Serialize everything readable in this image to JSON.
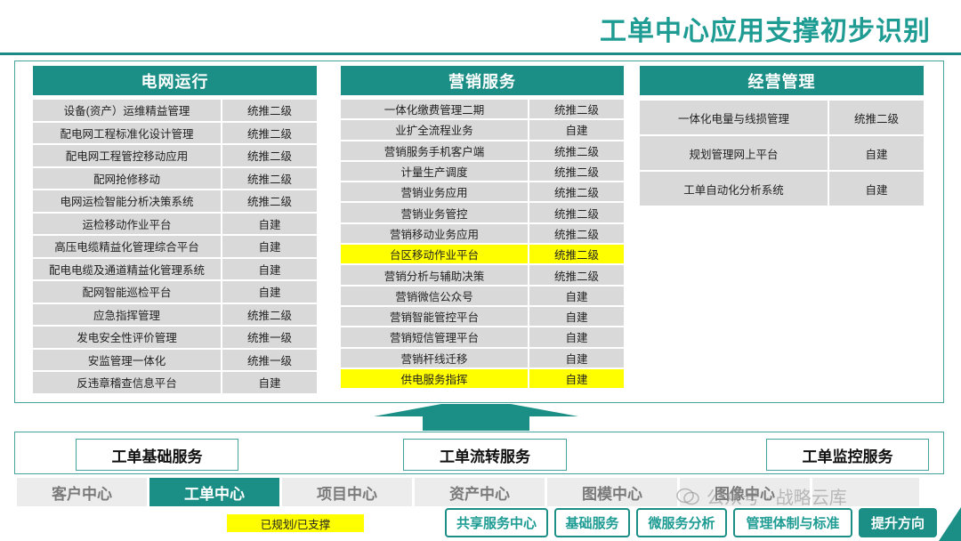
{
  "title": "工单中心应用支撑初步识别",
  "panels": {
    "grid": {
      "title": "电网运行",
      "rows": [
        {
          "name": "设备(资产）运维精益管理",
          "level": "统推二级"
        },
        {
          "name": "配电网工程标准化设计管理",
          "level": "统推二级"
        },
        {
          "name": "配电网工程管控移动应用",
          "level": "统推二级"
        },
        {
          "name": "配网抢修移动",
          "level": "统推二级"
        },
        {
          "name": "电网运检智能分析决策系统",
          "level": "统推二级"
        },
        {
          "name": "运检移动作业平台",
          "level": "自建"
        },
        {
          "name": "高压电缆精益化管理综合平台",
          "level": "自建"
        },
        {
          "name": "配电电缆及通道精益化管理系统",
          "level": "自建"
        },
        {
          "name": "配网智能巡检平台",
          "level": "自建"
        },
        {
          "name": "应急指挥管理",
          "level": "统推二级"
        },
        {
          "name": "发电安全性评价管理",
          "level": "统推一级"
        },
        {
          "name": "安监管理一体化",
          "level": "统推一级"
        },
        {
          "name": "反违章稽查信息平台",
          "level": "自建"
        }
      ]
    },
    "marketing": {
      "title": "营销服务",
      "rows": [
        {
          "name": "一体化缴费管理二期",
          "level": "统推二级",
          "highlight": false
        },
        {
          "name": "业扩全流程业务",
          "level": "自建",
          "highlight": false
        },
        {
          "name": "营销服务手机客户端",
          "level": "统推二级",
          "highlight": false
        },
        {
          "name": "计量生产调度",
          "level": "统推二级",
          "highlight": false
        },
        {
          "name": "营销业务应用",
          "level": "统推二级",
          "highlight": false
        },
        {
          "name": "营销业务管控",
          "level": "统推二级",
          "highlight": false
        },
        {
          "name": "营销移动业务应用",
          "level": "统推二级",
          "highlight": false
        },
        {
          "name": "台区移动作业平台",
          "level": "统推二级",
          "highlight": true
        },
        {
          "name": "营销分析与辅助决策",
          "level": "统推二级",
          "highlight": false
        },
        {
          "name": "营销微信公众号",
          "level": "自建",
          "highlight": false
        },
        {
          "name": "营销智能管控平台",
          "level": "自建",
          "highlight": false
        },
        {
          "name": "营销短信管理平台",
          "level": "自建",
          "highlight": false
        },
        {
          "name": "营销杆线迁移",
          "level": "自建",
          "highlight": false
        },
        {
          "name": "供电服务指挥",
          "level": "自建",
          "highlight": true
        }
      ]
    },
    "business": {
      "title": "经营管理",
      "rows": [
        {
          "name": "一体化电量与线损管理",
          "level": "统推二级"
        },
        {
          "name": "规划管理网上平台",
          "level": "自建"
        },
        {
          "name": "工单自动化分析系统",
          "level": "自建"
        }
      ]
    }
  },
  "services": {
    "basic": "工单基础服务",
    "flow": "工单流转服务",
    "monitor": "工单监控服务"
  },
  "centers": [
    {
      "label": "客户中心",
      "active": false
    },
    {
      "label": "工单中心",
      "active": true
    },
    {
      "label": "项目中心",
      "active": false
    },
    {
      "label": "资产中心",
      "active": false
    },
    {
      "label": "图模中心",
      "active": false
    },
    {
      "label": "图像中心",
      "active": false
    },
    {
      "label": "",
      "active": false
    }
  ],
  "legend": "已规划/已支撑",
  "nav": {
    "shared": "共享服务中心",
    "base": "基础服务",
    "micro": "微服务分析",
    "mgmt": "管理体制与标准",
    "up": "提升方向"
  },
  "watermark": "公众号 · 战略云库",
  "colors": {
    "accent": "#1b8f86",
    "title": "#1e9c93",
    "cell": "#d9d9d9",
    "highlight": "#ffff00"
  }
}
